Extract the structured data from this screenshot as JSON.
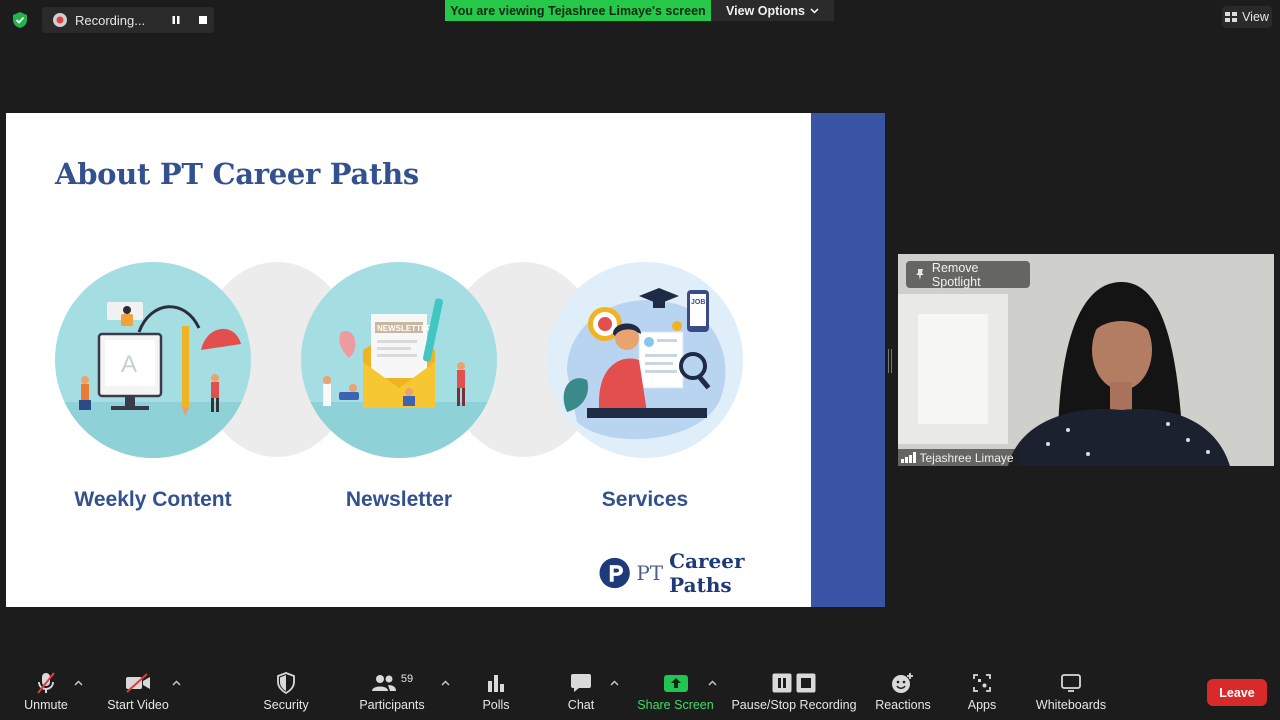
{
  "topbar": {
    "recording_label": "Recording...",
    "banner_text": "You are viewing Tejashree Limaye's screen",
    "view_options_label": "View Options",
    "view_label": "View"
  },
  "slide": {
    "title": "About PT Career Paths",
    "items": [
      {
        "caption": "Weekly Content"
      },
      {
        "caption": "Newsletter"
      },
      {
        "caption": "Services"
      }
    ],
    "logo_prefix": "PT",
    "logo_name": "Career Paths",
    "newsletter_tag": "NEWSLETTER",
    "job_tag": "JOB"
  },
  "video": {
    "spotlight_label": "Remove Spotlight",
    "participant_name": "Tejashree Limaye"
  },
  "toolbar": {
    "unmute": "Unmute",
    "start_video": "Start Video",
    "security": "Security",
    "participants": "Participants",
    "participants_count": "59",
    "polls": "Polls",
    "chat": "Chat",
    "share_screen": "Share Screen",
    "pause_stop_recording": "Pause/Stop Recording",
    "reactions": "Reactions",
    "apps": "Apps",
    "whiteboards": "Whiteboards",
    "leave": "Leave"
  },
  "colors": {
    "accent_green": "#26c84a",
    "slide_blue": "#33508f",
    "band_blue": "#3a55a5",
    "leave_red": "#d92a2a"
  }
}
